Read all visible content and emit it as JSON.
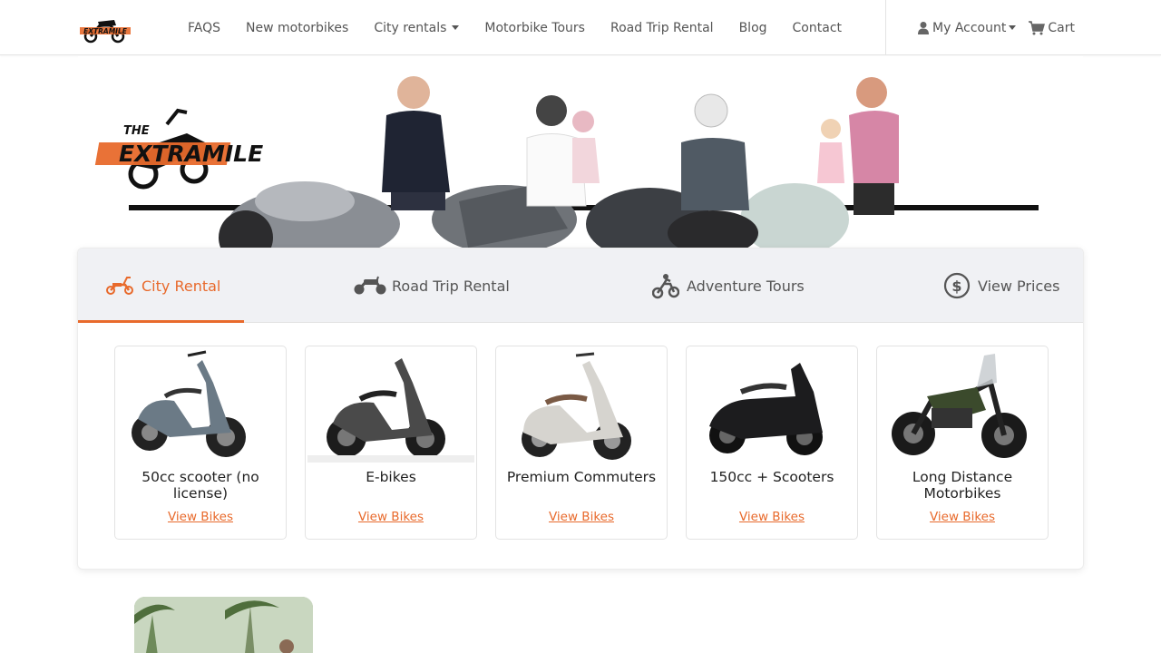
{
  "nav": {
    "logo_text": "EXTRAMILE",
    "links": [
      {
        "label": "FAQS"
      },
      {
        "label": "New motorbikes"
      },
      {
        "label": "City rentals"
      },
      {
        "label": "Motorbike Tours"
      },
      {
        "label": "Road Trip Rental"
      },
      {
        "label": "Blog"
      },
      {
        "label": "Contact"
      }
    ],
    "account_label": "My Account",
    "cart_label": "Cart"
  },
  "hero": {
    "logo_line1": "THE",
    "logo_line2": "EXTRAMILE"
  },
  "tabs": [
    {
      "label": "City Rental",
      "icon": "scooter-icon",
      "active": true
    },
    {
      "label": "Road Trip Rental",
      "icon": "motorbike-icon",
      "active": false
    },
    {
      "label": "Adventure Tours",
      "icon": "dirt-bike-icon",
      "active": false
    },
    {
      "label": "View Prices",
      "icon": "dollar-icon",
      "active": false
    }
  ],
  "bikes": [
    {
      "title": "50cc scooter (no license)",
      "link": "View Bikes",
      "color": "#6b7a86"
    },
    {
      "title": "E-bikes",
      "link": "View Bikes",
      "color": "#4a4a4a"
    },
    {
      "title": "Premium Commuters",
      "link": "View Bikes",
      "color": "#d6d4cf"
    },
    {
      "title": "150cc + Scooters",
      "link": "View Bikes",
      "color": "#1c1c1e"
    },
    {
      "title": "Long Distance Motorbikes",
      "link": "View Bikes",
      "color": "#3b4a2c"
    }
  ],
  "colors": {
    "accent": "#e86a2c",
    "tab_bg": "#f0f1f4"
  }
}
